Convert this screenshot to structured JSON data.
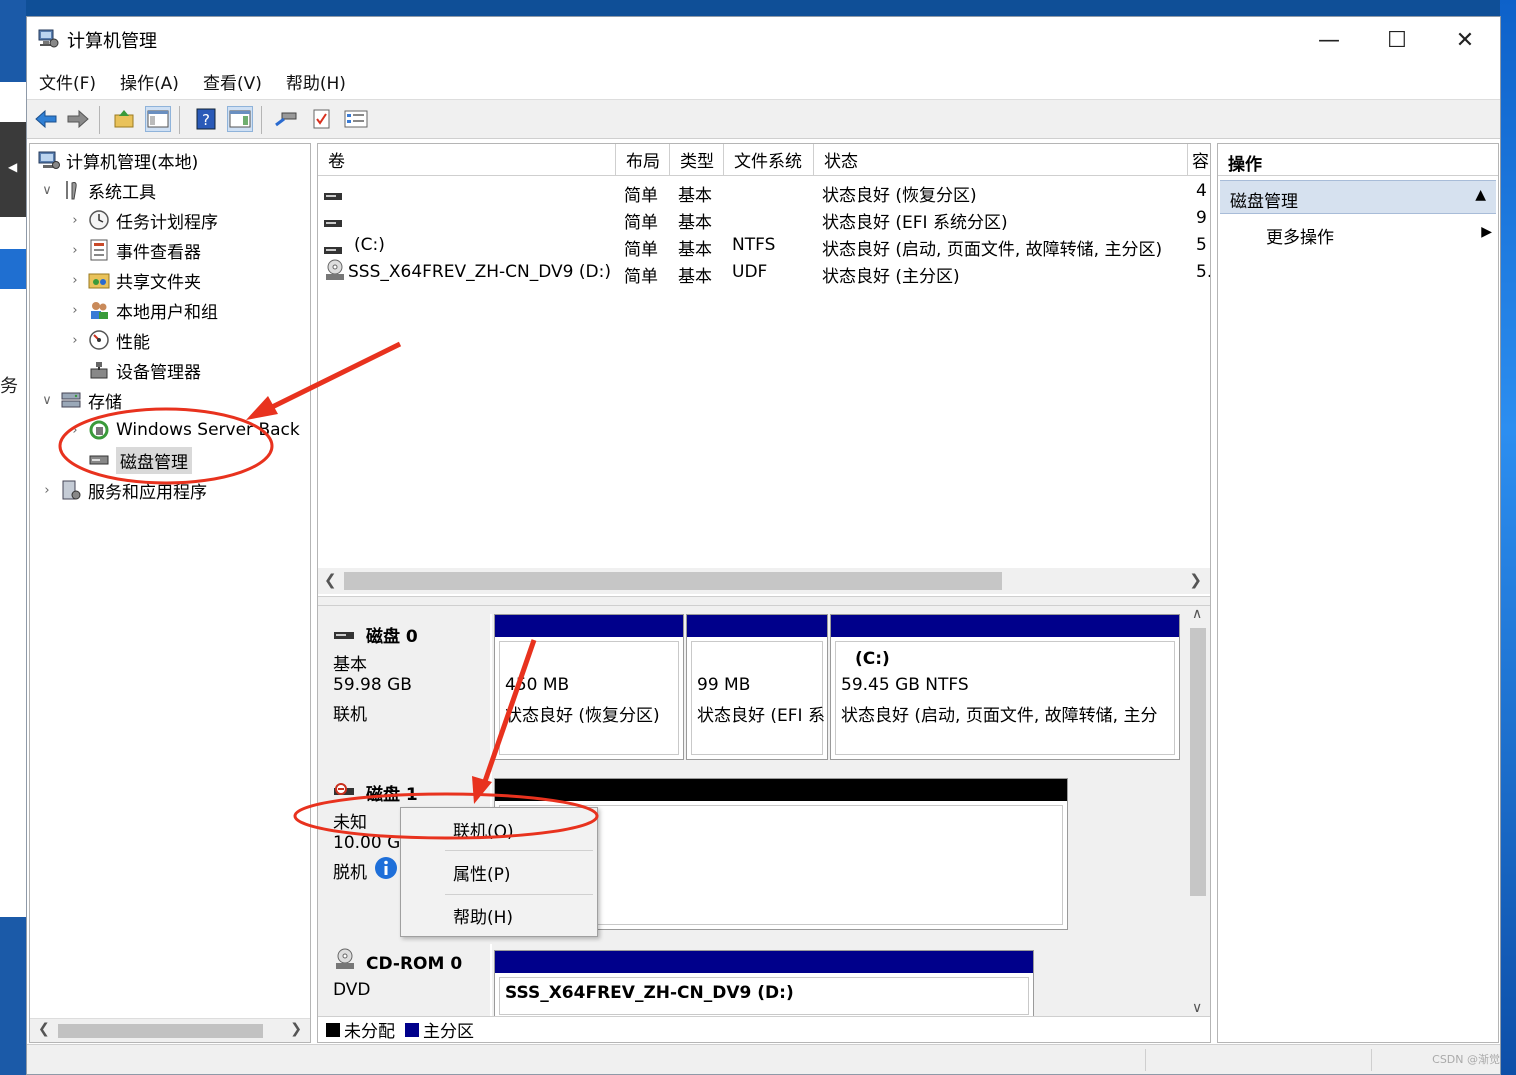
{
  "window": {
    "title": "计算机管理"
  },
  "desktop": {
    "left_char": "务",
    "left_arrow": "◀"
  },
  "menu": [
    "文件(F)",
    "操作(A)",
    "查看(V)",
    "帮助(H)"
  ],
  "tree": {
    "root": "计算机管理(本地)",
    "system_tools": "系统工具",
    "task_scheduler": "任务计划程序",
    "event_viewer": "事件查看器",
    "shared_folders": "共享文件夹",
    "local_users": "本地用户和组",
    "performance": "性能",
    "device_manager": "设备管理器",
    "storage": "存储",
    "windows_backup": "Windows Server Back",
    "disk_management": "磁盘管理",
    "services_apps": "服务和应用程序"
  },
  "volume_columns": [
    "卷",
    "布局",
    "类型",
    "文件系统",
    "状态",
    "容"
  ],
  "volumes": [
    {
      "name": "",
      "layout": "简单",
      "type": "基本",
      "fs": "",
      "status": "状态良好 (恢复分区)",
      "cap": "4"
    },
    {
      "name": "",
      "layout": "简单",
      "type": "基本",
      "fs": "",
      "status": "状态良好 (EFI 系统分区)",
      "cap": "9"
    },
    {
      "name": "(C:)",
      "layout": "简单",
      "type": "基本",
      "fs": "NTFS",
      "status": "状态良好 (启动, 页面文件, 故障转储, 主分区)",
      "cap": "5"
    },
    {
      "name": "SSS_X64FREV_ZH-CN_DV9 (D:)",
      "layout": "简单",
      "type": "基本",
      "fs": "UDF",
      "status": "状态良好 (主分区)",
      "cap": "5."
    }
  ],
  "disk0": {
    "name": "磁盘 0",
    "type": "基本",
    "size": "59.98 GB",
    "state": "联机",
    "partitions": [
      {
        "title": "",
        "size": "450 MB",
        "status": "状态良好 (恢复分区)"
      },
      {
        "title": "",
        "size": "99 MB",
        "status": "状态良好 (EFI 系"
      },
      {
        "title": "(C:)",
        "size": "59.45 GB NTFS",
        "status": "状态良好 (启动, 页面文件, 故障转储, 主分"
      }
    ]
  },
  "disk1": {
    "name": "磁盘 1",
    "type": "未知",
    "size": "10.00 G",
    "state": "脱机"
  },
  "cdrom": {
    "name": "CD-ROM 0",
    "type": "DVD",
    "volume": "SSS_X64FREV_ZH-CN_DV9  (D:)"
  },
  "legend": {
    "unallocated": "未分配",
    "primary": "主分区"
  },
  "context_menu": [
    "联机(O)",
    "属性(P)",
    "帮助(H)"
  ],
  "actions": {
    "header": "操作",
    "section": "磁盘管理",
    "more": "更多操作"
  },
  "watermark": "CSDN @渐觉",
  "colors": {
    "primary_partition": "#00008b",
    "unallocated": "#000000",
    "annotation": "#e8321e",
    "selection": "#d6e1ef"
  }
}
